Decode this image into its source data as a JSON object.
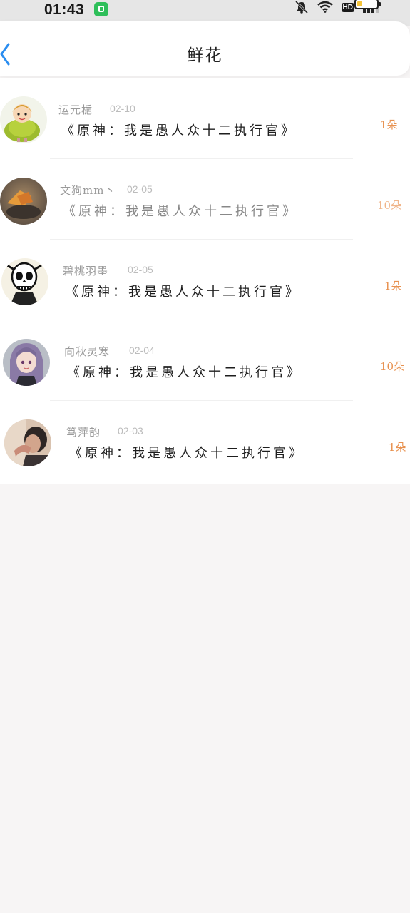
{
  "status_bar": {
    "time": "01:43",
    "hd_label": "HD",
    "battery_level": 0.25
  },
  "header": {
    "title": "鲜花"
  },
  "records": [
    {
      "name": "运元梔",
      "date": "02-10",
      "gift": "《原神：我是愚人众十二执行官》",
      "count": "1朵"
    },
    {
      "name": "文狗mm丶",
      "date": "02-05",
      "gift": "《原神：我是愚人众十二执行官》",
      "count": "10朵"
    },
    {
      "name": "碧桃羽墨",
      "date": "02-05",
      "gift": "《原神：我是愚人众十二执行官》",
      "count": "1朵"
    },
    {
      "name": "向秋灵寒",
      "date": "02-04",
      "gift": "《原神：我是愚人众十二执行官》",
      "count": "10朵"
    },
    {
      "name": "笃萍韵",
      "date": "02-03",
      "gift": "《原神：我是愚人众十二执行官》",
      "count": "1朵"
    }
  ],
  "colors": {
    "accent_count": "#e8914f",
    "back_arrow": "#2a8df0",
    "status_bar_bg": "#e6e6e6",
    "app_badge": "#2fbf5a",
    "battery_fill": "#f5c43a"
  }
}
